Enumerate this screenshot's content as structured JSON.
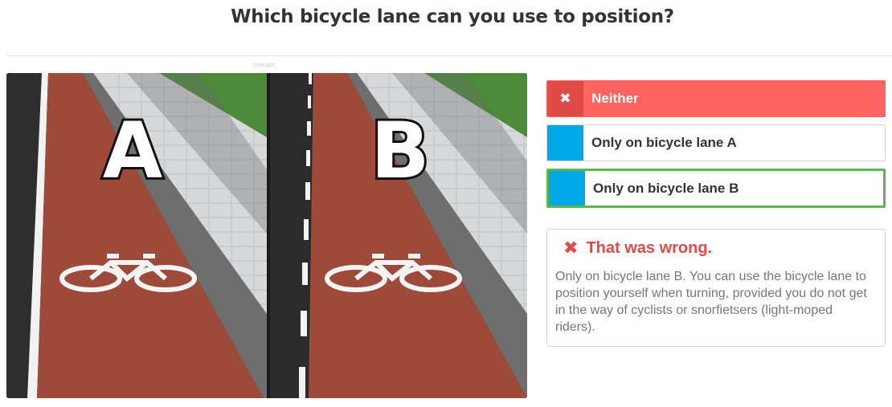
{
  "question": {
    "title": "Which bicycle lane can you use to position?",
    "image_caption": "27094 5827",
    "image_labels": {
      "left": "A",
      "right": "B"
    }
  },
  "answers": [
    {
      "label": "Neither",
      "state": "wrong-selected",
      "icon": "close-icon"
    },
    {
      "label": "Only on bicycle lane A",
      "state": "neutral"
    },
    {
      "label": "Only on bicycle lane B",
      "state": "correct"
    }
  ],
  "feedback": {
    "icon": "close-icon",
    "title": "That was wrong.",
    "body": "Only on bicycle lane B. You can use the bicycle lane to position yourself when turning, provided you do not get in the way of cyclists or snorfietsers (light-moped riders)."
  },
  "colors": {
    "wrong": "#fe6460",
    "wrong_dark": "#e04b47",
    "neutral_marker": "#00a8e6",
    "correct_border": "#59b74f",
    "lane": "#9e4a3a"
  }
}
